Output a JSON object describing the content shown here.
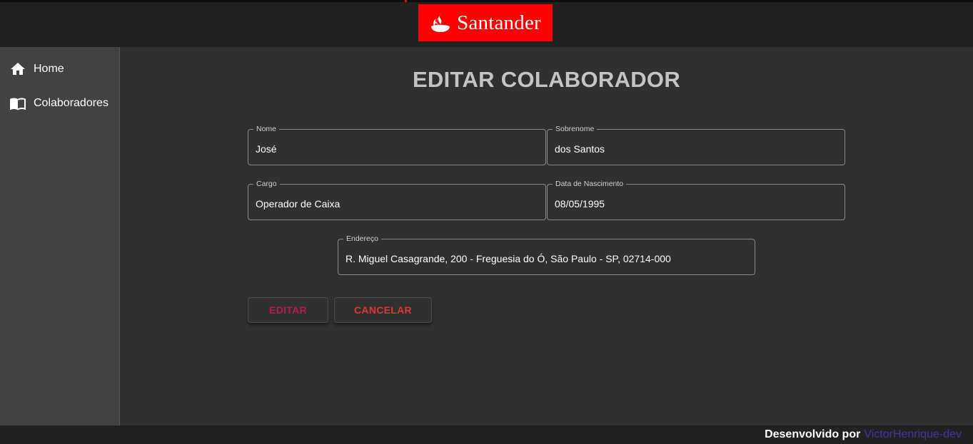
{
  "header": {
    "logo_text": "Santander",
    "colors": {
      "brand": "#ff0000",
      "header_bg": "#212121"
    }
  },
  "sidebar": {
    "items": [
      {
        "label": "Home",
        "icon": "home-icon"
      },
      {
        "label": "Colaboradores",
        "icon": "book-icon"
      }
    ]
  },
  "page": {
    "title": "EDITAR COLABORADOR"
  },
  "form": {
    "nome": {
      "label": "Nome",
      "value": "José"
    },
    "sobrenome": {
      "label": "Sobrenome",
      "value": "dos Santos"
    },
    "cargo": {
      "label": "Cargo",
      "value": "Operador de Caixa"
    },
    "data_nascimento": {
      "label": "Data de Nascimento",
      "value": "08/05/1995"
    },
    "endereco": {
      "label": "Endereço",
      "value": "R. Miguel Casagrande, 200 - Freguesia do Ó, São Paulo - SP, 02714-000"
    }
  },
  "buttons": {
    "edit_label": "EDITAR",
    "cancel_label": "CANCELAR",
    "colors": {
      "edit": "#b81a4a",
      "cancel": "#e03333"
    }
  },
  "footer": {
    "text": "Desenvolvido por",
    "link": "VictorHenrique-dev",
    "link_color": "#4b2fa0"
  }
}
